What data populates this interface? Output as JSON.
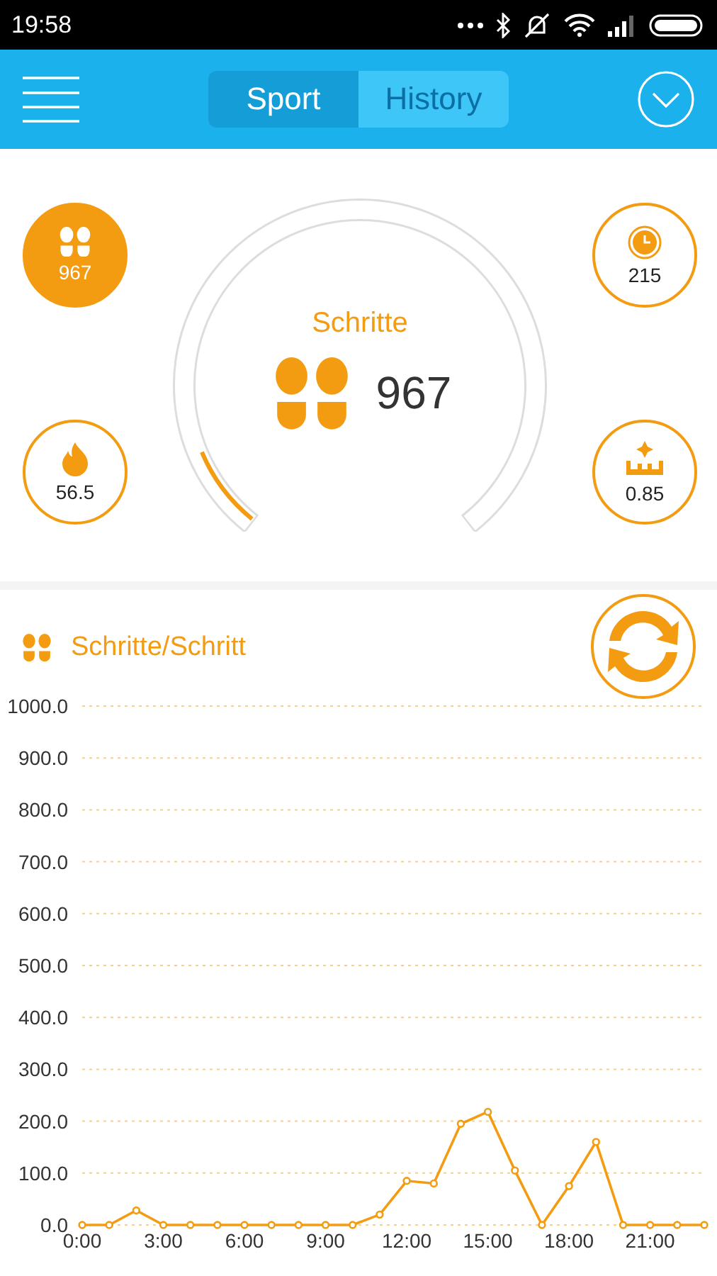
{
  "status_bar": {
    "time": "19:58"
  },
  "header": {
    "tabs": [
      {
        "label": "Sport",
        "selected": true
      },
      {
        "label": "History",
        "selected": false
      }
    ]
  },
  "stats": [
    {
      "kind": "steps",
      "value": "967",
      "selected": true
    },
    {
      "kind": "calories",
      "value": "56.5",
      "selected": false
    },
    {
      "kind": "time",
      "value": "215",
      "selected": false
    },
    {
      "kind": "distance",
      "value": "0.85",
      "selected": false
    }
  ],
  "gauge": {
    "label": "Schritte",
    "value": "967"
  },
  "chart": {
    "title": "Schritte/Schritt",
    "chart_data": {
      "type": "line",
      "x": [
        0,
        1,
        2,
        3,
        4,
        5,
        6,
        7,
        8,
        9,
        10,
        11,
        12,
        13,
        14,
        15,
        16,
        17,
        18,
        19,
        20,
        21,
        22,
        23
      ],
      "grid": true,
      "series": [
        {
          "color": "#f39c12",
          "marker": "circle",
          "values": [
            0,
            0,
            28,
            0,
            0,
            0,
            0,
            0,
            0,
            0,
            0,
            20,
            85,
            80,
            195,
            218,
            105,
            0,
            75,
            160,
            0,
            0,
            0,
            0
          ]
        }
      ],
      "ylim": [
        0,
        1000
      ],
      "xlim": [
        0,
        23
      ],
      "xticks": [
        {
          "value": 0,
          "label": "0:00"
        },
        {
          "value": 3,
          "label": "3:00"
        },
        {
          "value": 6,
          "label": "6:00"
        },
        {
          "value": 9,
          "label": "9:00"
        },
        {
          "value": 12,
          "label": "12:00"
        },
        {
          "value": 15,
          "label": "15:00"
        },
        {
          "value": 18,
          "label": "18:00"
        },
        {
          "value": 21,
          "label": "21:00"
        }
      ],
      "yticks": [
        {
          "value": 0,
          "label": "0.0"
        },
        {
          "value": 100,
          "label": "100.0"
        },
        {
          "value": 200,
          "label": "200.0"
        },
        {
          "value": 300,
          "label": "300.0"
        },
        {
          "value": 400,
          "label": "400.0"
        },
        {
          "value": 500,
          "label": "500.0"
        },
        {
          "value": 600,
          "label": "600.0"
        },
        {
          "value": 700,
          "label": "700.0"
        },
        {
          "value": 800,
          "label": "800.0"
        },
        {
          "value": 900,
          "label": "900.0"
        },
        {
          "value": 1000,
          "label": "1000.0"
        }
      ]
    }
  }
}
